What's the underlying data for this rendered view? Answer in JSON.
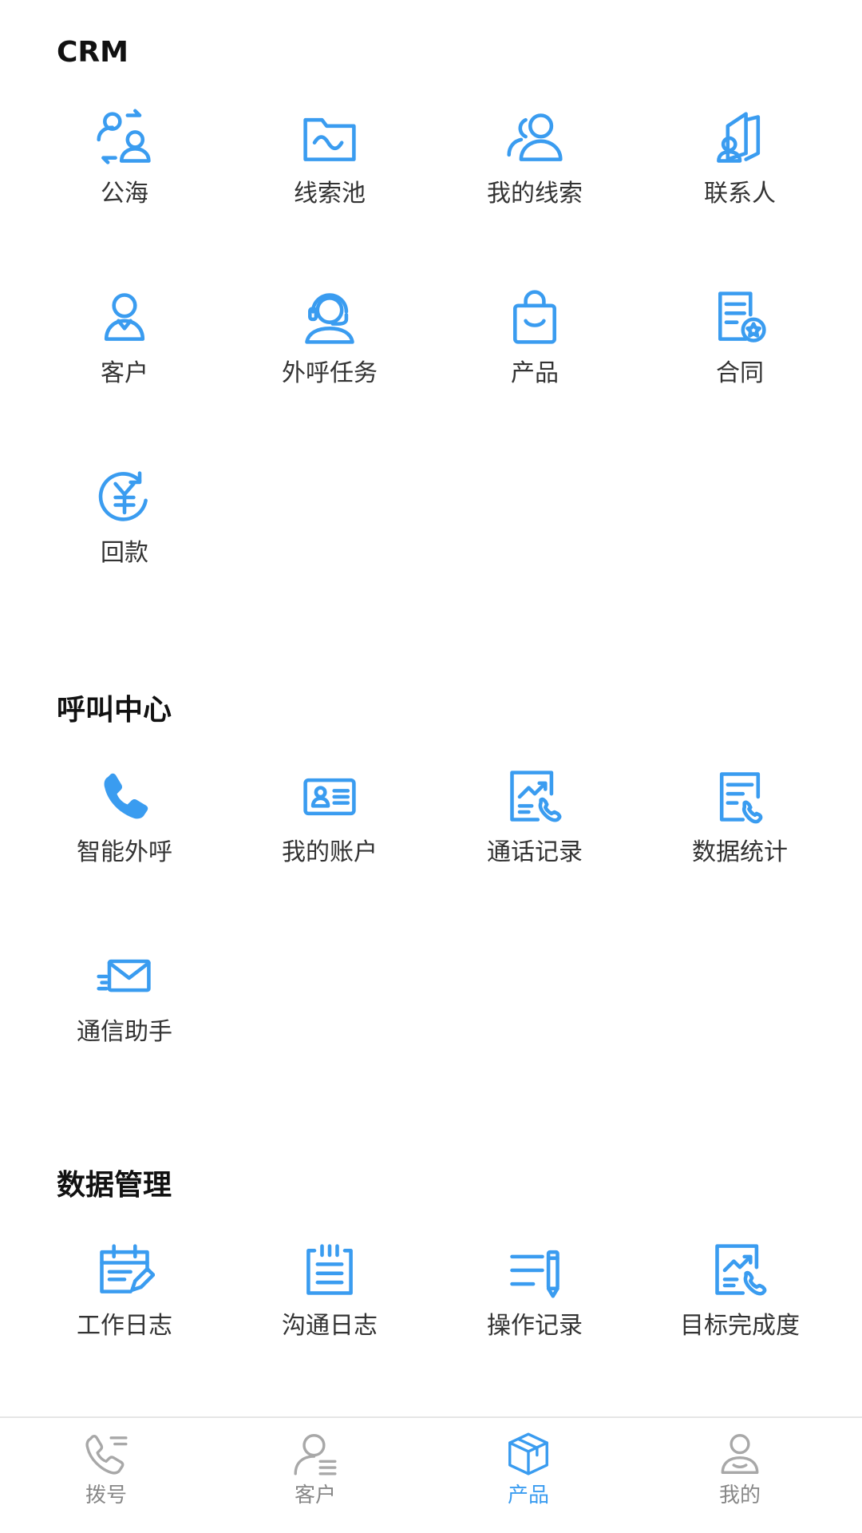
{
  "colors": {
    "accent": "#3a9cf0",
    "inactive": "#999999",
    "text": "#333333",
    "title": "#111111"
  },
  "crm": {
    "title": "CRM",
    "items": [
      {
        "label": "公海",
        "icon": "swap-users-icon"
      },
      {
        "label": "线索池",
        "icon": "folder-wave-icon"
      },
      {
        "label": "我的线索",
        "icon": "users-icon"
      },
      {
        "label": "联系人",
        "icon": "contact-cards-icon"
      },
      {
        "label": "客户",
        "icon": "customer-icon"
      },
      {
        "label": "外呼任务",
        "icon": "headset-icon"
      },
      {
        "label": "产品",
        "icon": "shopping-bag-icon"
      },
      {
        "label": "合同",
        "icon": "contract-icon"
      },
      {
        "label": "回款",
        "icon": "yuan-refund-icon"
      }
    ]
  },
  "call_center": {
    "title": "呼叫中心",
    "items": [
      {
        "label": "智能外呼",
        "icon": "phone-icon"
      },
      {
        "label": "我的账户",
        "icon": "id-card-icon"
      },
      {
        "label": "通话记录",
        "icon": "chart-phone-icon"
      },
      {
        "label": "数据统计",
        "icon": "document-phone-icon"
      },
      {
        "label": "通信助手",
        "icon": "mail-icon"
      }
    ]
  },
  "data_mgmt": {
    "title": "数据管理",
    "items": [
      {
        "label": "工作日志",
        "icon": "calendar-edit-icon"
      },
      {
        "label": "沟通日志",
        "icon": "notepad-icon"
      },
      {
        "label": "操作记录",
        "icon": "list-pen-icon"
      },
      {
        "label": "目标完成度",
        "icon": "chart-phone-icon"
      }
    ]
  },
  "tabbar": {
    "items": [
      {
        "label": "拨号",
        "icon": "dial-icon",
        "active": false
      },
      {
        "label": "客户",
        "icon": "customer-list-icon",
        "active": false
      },
      {
        "label": "产品",
        "icon": "box-icon",
        "active": true
      },
      {
        "label": "我的",
        "icon": "profile-icon",
        "active": false
      }
    ]
  }
}
